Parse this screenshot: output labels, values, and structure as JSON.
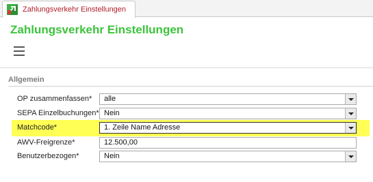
{
  "tab": {
    "label": "Zahlungsverkehr Einstellungen",
    "icon": "app-logo-icon"
  },
  "page_title": "Zahlungsverkehr Einstellungen",
  "menu": {
    "icon": "hamburger-menu-icon"
  },
  "section": {
    "title": "Allgemein",
    "fields": [
      {
        "label": "OP zusammenfassen*",
        "value": "alle",
        "type": "select"
      },
      {
        "label": "SEPA Einzelbuchungen*",
        "value": "Nein",
        "type": "select"
      },
      {
        "label": "Matchcode*",
        "value": "1. Zeile Name Adresse",
        "type": "select",
        "highlighted": true
      },
      {
        "label": "AWV-Freigrenze*",
        "value": "12.500,00",
        "type": "text"
      },
      {
        "label": "Benutzerbezogen*",
        "value": "Nein",
        "type": "select"
      }
    ]
  },
  "colors": {
    "title_green": "#3cc33b",
    "tab_label_red": "#b0202a",
    "highlight_yellow": "#ffff55"
  }
}
